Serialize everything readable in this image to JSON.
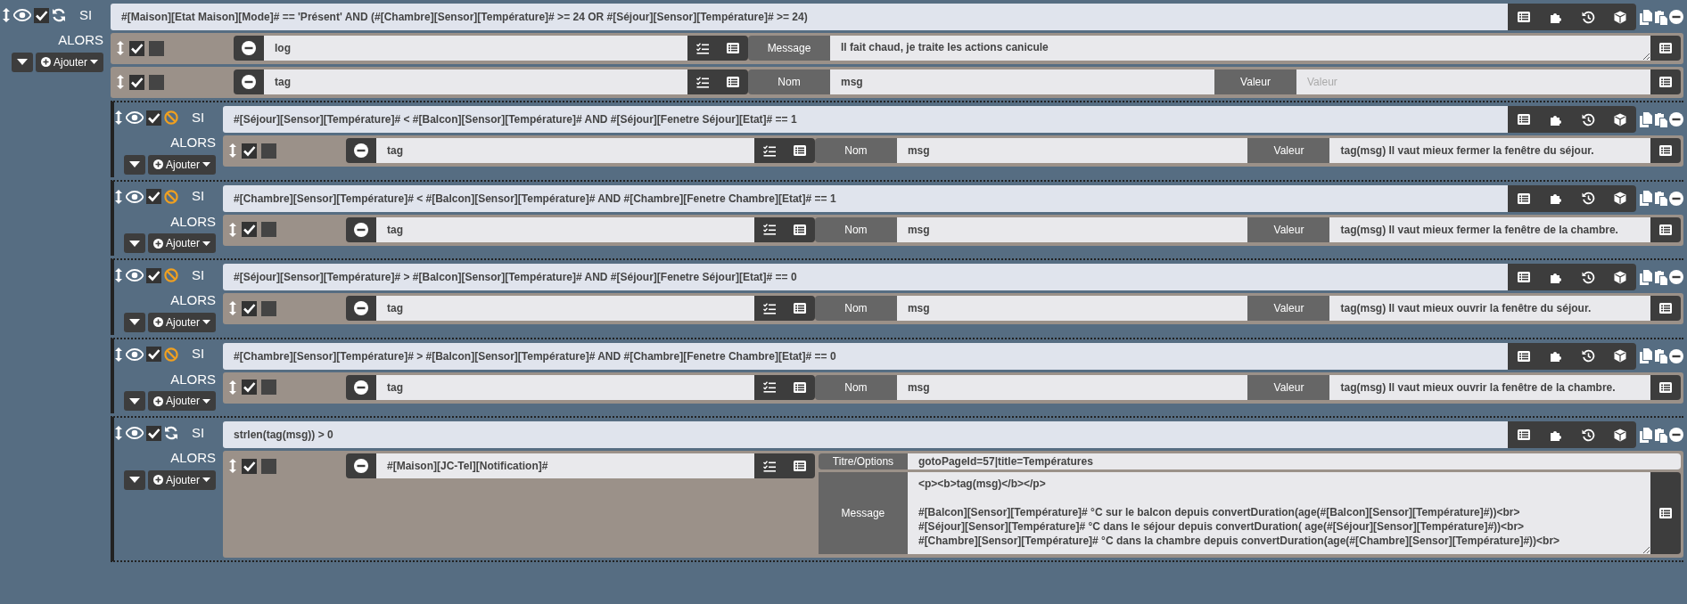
{
  "block": {
    "enabled": true,
    "repeat": true,
    "si_label": "SI",
    "condition": "#[Maison][Etat Maison][Mode]# == 'Présent' AND (#[Chambre][Sensor][Température]# >= 24 OR #[Séjour][Sensor][Température]# >= 24)",
    "alors_label": "ALORS",
    "add_label": "Ajouter",
    "actions": [
      {
        "kind": "action",
        "enabled": true,
        "parallel": false,
        "command": "log",
        "options": [
          {
            "kind": "textarea_list",
            "label": "Message",
            "value": "Il fait chaud, je traite les actions canicule"
          }
        ]
      },
      {
        "kind": "action",
        "enabled": true,
        "parallel": false,
        "command": "tag",
        "options": [
          {
            "kind": "text",
            "label": "Nom",
            "value": "msg"
          },
          {
            "kind": "text_list",
            "label": "Valeur",
            "placeholder": "Valeur"
          }
        ]
      },
      {
        "kind": "block",
        "enabled": true,
        "repeat": false,
        "si_label": "SI",
        "condition": "#[Séjour][Sensor][Température]# < #[Balcon][Sensor][Température]# AND #[Séjour][Fenetre Séjour][Etat]# == 1",
        "alors_label": "ALORS",
        "add_label": "Ajouter",
        "actions": [
          {
            "kind": "action",
            "enabled": true,
            "parallel": false,
            "command": "tag",
            "options": [
              {
                "kind": "text",
                "label": "Nom",
                "value": "msg"
              },
              {
                "kind": "text_list",
                "label": "Valeur",
                "value": "tag(msg) Il vaut mieux fermer la fenêtre du séjour."
              }
            ]
          }
        ]
      },
      {
        "kind": "block",
        "enabled": true,
        "repeat": false,
        "si_label": "SI",
        "condition": "#[Chambre][Sensor][Température]# < #[Balcon][Sensor][Température]# AND #[Chambre][Fenetre Chambre][Etat]# == 1",
        "alors_label": "ALORS",
        "add_label": "Ajouter",
        "actions": [
          {
            "kind": "action",
            "enabled": true,
            "parallel": false,
            "command": "tag",
            "options": [
              {
                "kind": "text",
                "label": "Nom",
                "value": "msg"
              },
              {
                "kind": "text_list",
                "label": "Valeur",
                "value": "tag(msg) Il vaut mieux fermer la fenêtre de la chambre."
              }
            ]
          }
        ]
      },
      {
        "kind": "block",
        "enabled": true,
        "repeat": false,
        "si_label": "SI",
        "condition": "#[Séjour][Sensor][Température]# > #[Balcon][Sensor][Température]# AND #[Séjour][Fenetre Séjour][Etat]# == 0",
        "alors_label": "ALORS",
        "add_label": "Ajouter",
        "actions": [
          {
            "kind": "action",
            "enabled": true,
            "parallel": false,
            "command": "tag",
            "options": [
              {
                "kind": "text",
                "label": "Nom",
                "value": "msg"
              },
              {
                "kind": "text_list",
                "label": "Valeur",
                "value": "tag(msg) Il vaut mieux ouvrir la fenêtre du séjour."
              }
            ]
          }
        ]
      },
      {
        "kind": "block",
        "enabled": true,
        "repeat": false,
        "si_label": "SI",
        "condition": "#[Chambre][Sensor][Température]# > #[Balcon][Sensor][Température]# AND  #[Chambre][Fenetre Chambre][Etat]# == 0",
        "alors_label": "ALORS",
        "add_label": "Ajouter",
        "actions": [
          {
            "kind": "action",
            "enabled": true,
            "parallel": false,
            "command": "tag",
            "options": [
              {
                "kind": "text",
                "label": "Nom",
                "value": "msg"
              },
              {
                "kind": "text_list",
                "label": "Valeur",
                "value": "tag(msg) Il vaut mieux ouvrir la fenêtre de la chambre."
              }
            ]
          }
        ]
      },
      {
        "kind": "block",
        "enabled": true,
        "repeat": true,
        "si_label": "SI",
        "condition": "strlen(tag(msg)) > 0",
        "alors_label": "ALORS",
        "add_label": "Ajouter",
        "actions": [
          {
            "kind": "stacked_action",
            "enabled": true,
            "parallel": false,
            "command": "#[Maison][JC-Tel][Notification]#",
            "options": [
              {
                "kind": "text",
                "label": "Titre/Options",
                "value": "gotoPageId=57|title=Températures"
              },
              {
                "kind": "textarea_list",
                "label": "Message",
                "value": "<p><b>tag(msg)</b></p>\n\n#[Balcon][Sensor][Température]# °C sur le balcon depuis convertDuration(age(#[Balcon][Sensor][Température]#))<br>\n#[Séjour][Sensor][Température]# °C dans le séjour depuis convertDuration( age(#[Séjour][Sensor][Température]#))<br>\n#[Chambre][Sensor][Température]# °C dans la chambre depuis convertDuration(age(#[Chambre][Sensor][Température]#))<br>"
              }
            ]
          }
        ]
      }
    ]
  }
}
